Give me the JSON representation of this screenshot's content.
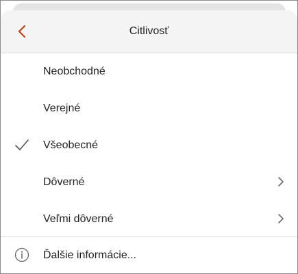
{
  "header": {
    "title": "Citlivosť",
    "back_icon": "chevron-left-icon",
    "accent_color": "#c43e1c"
  },
  "menu": {
    "items": [
      {
        "label": "Neobchodné",
        "selected": false,
        "has_submenu": false
      },
      {
        "label": "Verejné",
        "selected": false,
        "has_submenu": false
      },
      {
        "label": "Všeobecné",
        "selected": true,
        "has_submenu": false
      },
      {
        "label": "Dôverné",
        "selected": false,
        "has_submenu": true
      },
      {
        "label": "Veľmi dôverné",
        "selected": false,
        "has_submenu": true
      }
    ]
  },
  "footer": {
    "label": "Ďalšie informácie...",
    "icon": "info-icon"
  }
}
